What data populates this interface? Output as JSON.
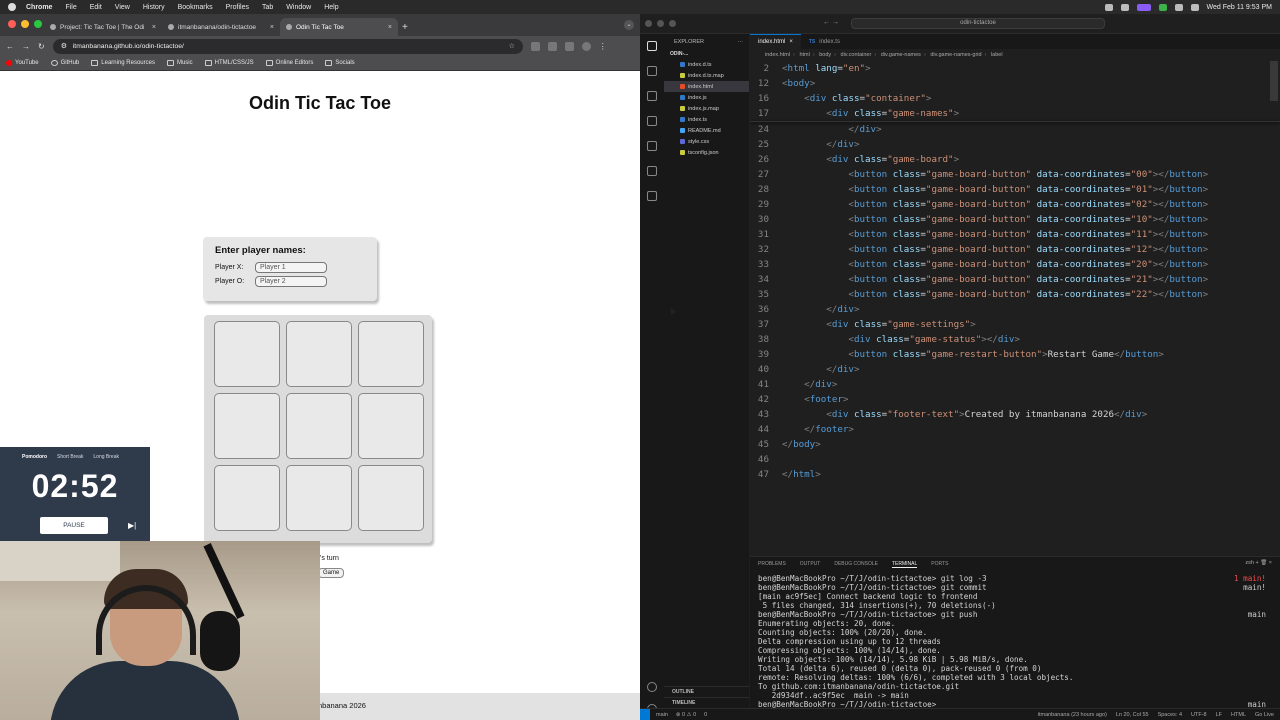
{
  "menubar": {
    "app": "Chrome",
    "items": [
      "File",
      "Edit",
      "View",
      "History",
      "Bookmarks",
      "Profiles",
      "Tab",
      "Window",
      "Help"
    ],
    "clock": "Wed Feb 11  9:53 PM"
  },
  "browser": {
    "tabs": [
      {
        "label": "Project: Tic Tac Toe | The Odi"
      },
      {
        "label": "itmanbanana/odin-tictactoe"
      },
      {
        "label": "Odin Tic Tac Toe"
      }
    ],
    "url": "itmanbanana.github.io/odin-tictactoe/",
    "bookmarks": [
      "YouTube",
      "GitHub",
      "Learning Resources",
      "Music",
      "HTML/CSS/JS",
      "Online Editors",
      "Socials"
    ]
  },
  "page": {
    "title": "Odin Tic Tac Toe",
    "names_heading": "Enter player names:",
    "player_x_label": "Player X:",
    "player_x_placeholder": "Player 1",
    "player_o_label": "Player O:",
    "player_o_placeholder": "Player 2",
    "turn_text": "'s turn",
    "restart_label": "Game",
    "footer_text": "nbanana 2026"
  },
  "pomodoro": {
    "modes": [
      "Pomodoro",
      "Short Break",
      "Long Break"
    ],
    "active_mode": "Pomodoro",
    "time": "02:52",
    "pause_label": "PAUSE",
    "accent": "#2f3a4a"
  },
  "vscode": {
    "search": "odin-tictactoe",
    "explorer_title": "EXPLORER",
    "project": "ODIN-...",
    "files": [
      {
        "name": "index.d.ts",
        "type": "ts"
      },
      {
        "name": "index.d.ts.map",
        "type": "json"
      },
      {
        "name": "index.html",
        "type": "html",
        "selected": true
      },
      {
        "name": "index.js",
        "type": "ts"
      },
      {
        "name": "index.js.map",
        "type": "json"
      },
      {
        "name": "index.ts",
        "type": "ts"
      },
      {
        "name": "README.md",
        "type": "md"
      },
      {
        "name": "style.css",
        "type": "css"
      },
      {
        "name": "tsconfig.json",
        "type": "json"
      }
    ],
    "outline": "OUTLINE",
    "timeline": "TIMELINE",
    "editor_tabs": [
      {
        "label": "index.html",
        "active": true
      },
      {
        "label": "index.ts",
        "active": false
      }
    ],
    "breadcrumbs": [
      "index.html",
      "html",
      "body",
      "div.container",
      "div.game-names",
      "div.game-names-grid",
      "label"
    ],
    "code_lines": [
      {
        "n": "2",
        "html": "<span class=\"t\">&lt;</span><span class=\"tg\">html</span> <span class=\"at\">lang</span>=<span class=\"st\">\"en\"</span><span class=\"t\">&gt;</span>",
        "indent": 0
      },
      {
        "n": "12",
        "html": "<span class=\"t\">&lt;</span><span class=\"tg\">body</span><span class=\"t\">&gt;</span>",
        "indent": 0
      },
      {
        "n": "16",
        "html": "<span class=\"t\">&lt;</span><span class=\"tg\">div</span> <span class=\"at\">class</span>=<span class=\"st\">\"container\"</span><span class=\"t\">&gt;</span>",
        "indent": 1
      },
      {
        "n": "17",
        "html": "<span class=\"t\">&lt;</span><span class=\"tg\">div</span> <span class=\"at\">class</span>=<span class=\"st\">\"game-names\"</span><span class=\"t\">&gt;</span>",
        "indent": 2
      },
      {
        "n": "24",
        "html": "<span class=\"t\">&lt;/</span><span class=\"tg\">div</span><span class=\"t\">&gt;</span>",
        "indent": 3
      },
      {
        "n": "25",
        "html": "<span class=\"t\">&lt;/</span><span class=\"tg\">div</span><span class=\"t\">&gt;</span>",
        "indent": 2
      },
      {
        "n": "26",
        "html": "<span class=\"t\">&lt;</span><span class=\"tg\">div</span> <span class=\"at\">class</span>=<span class=\"st\">\"game-board\"</span><span class=\"t\">&gt;</span>",
        "indent": 2
      },
      {
        "n": "27",
        "html": "<span class=\"t\">&lt;</span><span class=\"tg\">button</span> <span class=\"at\">class</span>=<span class=\"st\">\"game-board-button\"</span> <span class=\"at\">data-coordinates</span>=<span class=\"st\">\"00\"</span><span class=\"t\">&gt;&lt;/</span><span class=\"tg\">button</span><span class=\"t\">&gt;</span>",
        "indent": 3
      },
      {
        "n": "28",
        "html": "<span class=\"t\">&lt;</span><span class=\"tg\">button</span> <span class=\"at\">class</span>=<span class=\"st\">\"game-board-button\"</span> <span class=\"at\">data-coordinates</span>=<span class=\"st\">\"01\"</span><span class=\"t\">&gt;&lt;/</span><span class=\"tg\">button</span><span class=\"t\">&gt;</span>",
        "indent": 3
      },
      {
        "n": "29",
        "html": "<span class=\"t\">&lt;</span><span class=\"tg\">button</span> <span class=\"at\">class</span>=<span class=\"st\">\"game-board-button\"</span> <span class=\"at\">data-coordinates</span>=<span class=\"st\">\"02\"</span><span class=\"t\">&gt;&lt;/</span><span class=\"tg\">button</span><span class=\"t\">&gt;</span>",
        "indent": 3
      },
      {
        "n": "30",
        "html": "<span class=\"t\">&lt;</span><span class=\"tg\">button</span> <span class=\"at\">class</span>=<span class=\"st\">\"game-board-button\"</span> <span class=\"at\">data-coordinates</span>=<span class=\"st\">\"10\"</span><span class=\"t\">&gt;&lt;/</span><span class=\"tg\">button</span><span class=\"t\">&gt;</span>",
        "indent": 3
      },
      {
        "n": "31",
        "html": "<span class=\"t\">&lt;</span><span class=\"tg\">button</span> <span class=\"at\">class</span>=<span class=\"st\">\"game-board-button\"</span> <span class=\"at\">data-coordinates</span>=<span class=\"st\">\"11\"</span><span class=\"t\">&gt;&lt;/</span><span class=\"tg\">button</span><span class=\"t\">&gt;</span>",
        "indent": 3
      },
      {
        "n": "32",
        "html": "<span class=\"t\">&lt;</span><span class=\"tg\">button</span> <span class=\"at\">class</span>=<span class=\"st\">\"game-board-button\"</span> <span class=\"at\">data-coordinates</span>=<span class=\"st\">\"12\"</span><span class=\"t\">&gt;&lt;/</span><span class=\"tg\">button</span><span class=\"t\">&gt;</span>",
        "indent": 3
      },
      {
        "n": "33",
        "html": "<span class=\"t\">&lt;</span><span class=\"tg\">button</span> <span class=\"at\">class</span>=<span class=\"st\">\"game-board-button\"</span> <span class=\"at\">data-coordinates</span>=<span class=\"st\">\"20\"</span><span class=\"t\">&gt;&lt;/</span><span class=\"tg\">button</span><span class=\"t\">&gt;</span>",
        "indent": 3
      },
      {
        "n": "34",
        "html": "<span class=\"t\">&lt;</span><span class=\"tg\">button</span> <span class=\"at\">class</span>=<span class=\"st\">\"game-board-button\"</span> <span class=\"at\">data-coordinates</span>=<span class=\"st\">\"21\"</span><span class=\"t\">&gt;&lt;/</span><span class=\"tg\">button</span><span class=\"t\">&gt;</span>",
        "indent": 3
      },
      {
        "n": "35",
        "html": "<span class=\"t\">&lt;</span><span class=\"tg\">button</span> <span class=\"at\">class</span>=<span class=\"st\">\"game-board-button\"</span> <span class=\"at\">data-coordinates</span>=<span class=\"st\">\"22\"</span><span class=\"t\">&gt;&lt;/</span><span class=\"tg\">button</span><span class=\"t\">&gt;</span>",
        "indent": 3
      },
      {
        "n": "36",
        "html": "<span class=\"t\">&lt;/</span><span class=\"tg\">div</span><span class=\"t\">&gt;</span>",
        "indent": 2
      },
      {
        "n": "37",
        "html": "<span class=\"t\">&lt;</span><span class=\"tg\">div</span> <span class=\"at\">class</span>=<span class=\"st\">\"game-settings\"</span><span class=\"t\">&gt;</span>",
        "indent": 2
      },
      {
        "n": "38",
        "html": "<span class=\"t\">&lt;</span><span class=\"tg\">div</span> <span class=\"at\">class</span>=<span class=\"st\">\"game-status\"</span><span class=\"t\">&gt;&lt;/</span><span class=\"tg\">div</span><span class=\"t\">&gt;</span>",
        "indent": 3
      },
      {
        "n": "39",
        "html": "<span class=\"t\">&lt;</span><span class=\"tg\">button</span> <span class=\"at\">class</span>=<span class=\"st\">\"game-restart-button\"</span><span class=\"t\">&gt;</span><span class=\"tx\">Restart Game</span><span class=\"t\">&lt;/</span><span class=\"tg\">button</span><span class=\"t\">&gt;</span>",
        "indent": 3
      },
      {
        "n": "40",
        "html": "<span class=\"t\">&lt;/</span><span class=\"tg\">div</span><span class=\"t\">&gt;</span>",
        "indent": 2
      },
      {
        "n": "41",
        "html": "<span class=\"t\">&lt;/</span><span class=\"tg\">div</span><span class=\"t\">&gt;</span>",
        "indent": 1
      },
      {
        "n": "42",
        "html": "<span class=\"t\">&lt;</span><span class=\"tg\">footer</span><span class=\"t\">&gt;</span>",
        "indent": 1
      },
      {
        "n": "43",
        "html": "<span class=\"t\">&lt;</span><span class=\"tg\">div</span> <span class=\"at\">class</span>=<span class=\"st\">\"footer-text\"</span><span class=\"t\">&gt;</span><span class=\"tx\">Created by itmanbanana 2026</span><span class=\"t\">&lt;/</span><span class=\"tg\">div</span><span class=\"t\">&gt;</span>",
        "indent": 2
      },
      {
        "n": "44",
        "html": "<span class=\"t\">&lt;/</span><span class=\"tg\">footer</span><span class=\"t\">&gt;</span>",
        "indent": 1
      },
      {
        "n": "45",
        "html": "<span class=\"t\">&lt;/</span><span class=\"tg\">body</span><span class=\"t\">&gt;</span>",
        "indent": 0
      },
      {
        "n": "46",
        "html": "",
        "indent": 0
      },
      {
        "n": "47",
        "html": "<span class=\"t\">&lt;/</span><span class=\"tg\">html</span><span class=\"t\">&gt;</span>",
        "indent": 0
      }
    ],
    "panel_tabs": [
      "PROBLEMS",
      "OUTPUT",
      "DEBUG CONSOLE",
      "TERMINAL",
      "PORTS"
    ],
    "active_panel_tab": "TERMINAL",
    "panel_shell": "zsh",
    "terminal_lines": [
      {
        "text": "ben@BenMacBookPro ~/T/J/odin-tictactoe> git log -3",
        "right": "1 main!",
        "right_red": true
      },
      {
        "text": "ben@BenMacBookPro ~/T/J/odin-tictactoe> git commit",
        "right": "main!",
        "right_red": false
      },
      {
        "text": "[main ac9f5ec] Connect backend logic to frontend",
        "right": "",
        "right_red": false
      },
      {
        "text": " 5 files changed, 314 insertions(+), 70 deletions(-)",
        "right": "",
        "right_red": false
      },
      {
        "text": "ben@BenMacBookPro ~/T/J/odin-tictactoe> git push",
        "right": "main",
        "right_red": false
      },
      {
        "text": "Enumerating objects: 20, done.",
        "right": "",
        "right_red": false
      },
      {
        "text": "Counting objects: 100% (20/20), done.",
        "right": "",
        "right_red": false
      },
      {
        "text": "Delta compression using up to 12 threads",
        "right": "",
        "right_red": false
      },
      {
        "text": "Compressing objects: 100% (14/14), done.",
        "right": "",
        "right_red": false
      },
      {
        "text": "Writing objects: 100% (14/14), 5.98 KiB | 5.98 MiB/s, done.",
        "right": "",
        "right_red": false
      },
      {
        "text": "Total 14 (delta 6), reused 0 (delta 0), pack-reused 0 (from 0)",
        "right": "",
        "right_red": false
      },
      {
        "text": "remote: Resolving deltas: 100% (6/6), completed with 3 local objects.",
        "right": "",
        "right_red": false
      },
      {
        "text": "To github.com:itmanbanana/odin-tictactoe.git",
        "right": "",
        "right_red": false
      },
      {
        "text": "   2d934df..ac9f5ec  main -> main",
        "right": "",
        "right_red": false
      },
      {
        "text": "ben@BenMacBookPro ~/T/J/odin-tictactoe> ",
        "right": "main",
        "right_red": false
      }
    ],
    "status": {
      "branch": "main",
      "problems": "⊗ 0 ⚠ 0",
      "ports": "0",
      "blame": "itmanbanana (23 hours ago)",
      "position": "Ln 20, Col 55",
      "spaces": "Spaces: 4",
      "encoding": "UTF-8",
      "eol": "LF",
      "language": "HTML",
      "live": "Go Live"
    }
  }
}
